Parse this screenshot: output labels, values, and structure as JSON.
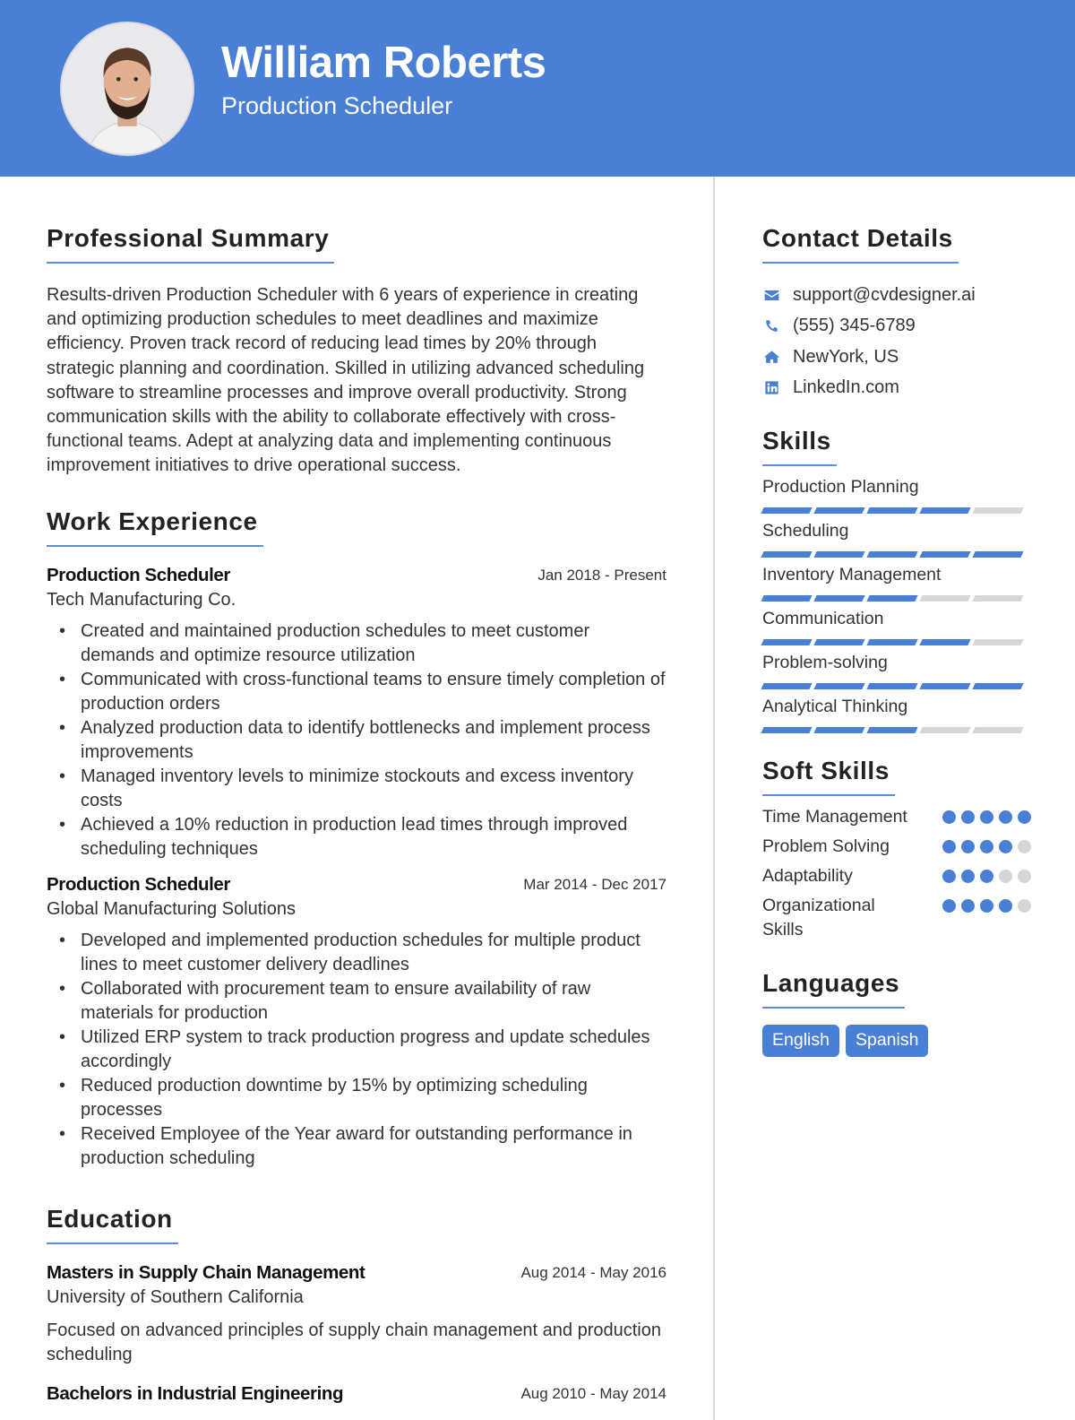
{
  "header": {
    "name": "William Roberts",
    "title": "Production Scheduler",
    "photo_alt": "profile-photo"
  },
  "summary": {
    "heading": "Professional Summary",
    "text": "Results-driven Production Scheduler with 6 years of experience in creating and optimizing production schedules to meet deadlines and maximize efficiency. Proven track record of reducing lead times by 20% through strategic planning and coordination. Skilled in utilizing advanced scheduling software to streamline processes and improve overall productivity. Strong communication skills with the ability to collaborate effectively with cross-functional teams. Adept at analyzing data and implementing continuous improvement initiatives to drive operational success."
  },
  "experience": {
    "heading": "Work Experience",
    "jobs": [
      {
        "title": "Production Scheduler",
        "date": "Jan 2018 - Present",
        "company": "Tech Manufacturing Co.",
        "bullets": [
          "Created and maintained production schedules to meet customer demands and optimize resource utilization",
          "Communicated with cross-functional teams to ensure timely completion of production orders",
          "Analyzed production data to identify bottlenecks and implement process improvements",
          "Managed inventory levels to minimize stockouts and excess inventory costs",
          "Achieved a 10% reduction in production lead times through improved scheduling techniques"
        ]
      },
      {
        "title": "Production Scheduler",
        "date": "Mar 2014 - Dec 2017",
        "company": "Global Manufacturing Solutions",
        "bullets": [
          "Developed and implemented production schedules for multiple product lines to meet customer delivery deadlines",
          "Collaborated with procurement team to ensure availability of raw materials for production",
          "Utilized ERP system to track production progress and update schedules accordingly",
          "Reduced production downtime by 15% by optimizing scheduling processes",
          "Received Employee of the Year award for outstanding performance in production scheduling"
        ]
      }
    ]
  },
  "education": {
    "heading": "Education",
    "items": [
      {
        "degree": "Masters in Supply Chain Management",
        "date": "Aug 2014 - May 2016",
        "school": "University of Southern California",
        "description": "Focused on advanced principles of supply chain management and production scheduling"
      },
      {
        "degree": "Bachelors in Industrial Engineering",
        "date": "Aug 2010 - May 2014"
      }
    ]
  },
  "contact": {
    "heading": "Contact Details",
    "items": [
      {
        "icon": "envelope-icon",
        "text": "support@cvdesigner.ai"
      },
      {
        "icon": "phone-icon",
        "text": "(555) 345-6789"
      },
      {
        "icon": "home-icon",
        "text": "NewYork, US"
      },
      {
        "icon": "linkedin-icon",
        "text": "LinkedIn.com"
      }
    ]
  },
  "skills": {
    "heading": "Skills",
    "max": 5,
    "items": [
      {
        "name": "Production Planning",
        "level": 4
      },
      {
        "name": "Scheduling",
        "level": 5
      },
      {
        "name": "Inventory Management",
        "level": 3
      },
      {
        "name": "Communication",
        "level": 4
      },
      {
        "name": "Problem-solving",
        "level": 5
      },
      {
        "name": "Analytical Thinking",
        "level": 3
      }
    ]
  },
  "soft_skills": {
    "heading": "Soft Skills",
    "max": 5,
    "items": [
      {
        "name": "Time Management",
        "level": 5
      },
      {
        "name": "Problem Solving",
        "level": 4
      },
      {
        "name": "Adaptability",
        "level": 3
      },
      {
        "name": "Organizational Skills",
        "level": 4
      }
    ]
  },
  "languages": {
    "heading": "Languages",
    "items": [
      "English",
      "Spanish"
    ]
  },
  "colors": {
    "accent": "#4a7fd6",
    "inactive": "#d6d6d6"
  }
}
